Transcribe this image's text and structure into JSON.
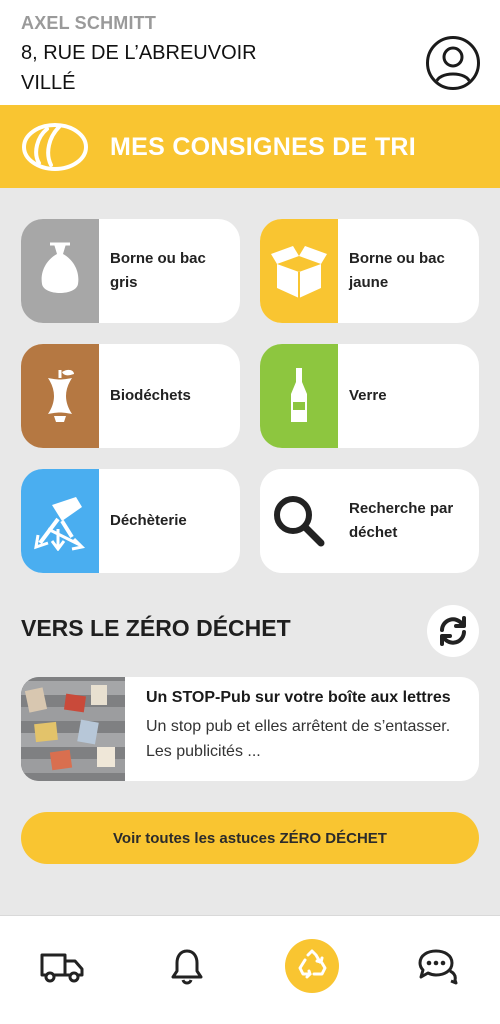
{
  "user": {
    "name": "AXEL SCHMITT",
    "street": "8, RUE DE L’ABREUVOIR",
    "city": "VILLÉ",
    "icon": "user-circle-icon"
  },
  "banner": {
    "title": "MES CONSIGNES DE TRI",
    "icon": "bread-logo-icon"
  },
  "tiles": [
    {
      "label": "Borne ou bac\ngris",
      "color": "#a7a7a7",
      "icon": "trash-bag-icon"
    },
    {
      "label": "Borne ou bac\njaune",
      "color": "#f9c531",
      "icon": "box-icon"
    },
    {
      "label": "Biodéchets",
      "color": "#b57842",
      "icon": "apple-core-icon"
    },
    {
      "label": "Verre",
      "color": "#8dc63f",
      "icon": "bottle-icon"
    },
    {
      "label": "Déchèterie",
      "color": "#4aaef0",
      "icon": "recycling-center-icon"
    },
    {
      "label": "Recherche par\ndéchet",
      "color": "#ffffff",
      "icon": "search-icon"
    }
  ],
  "zero": {
    "title": "VERS LE ZÉRO DÉCHET",
    "refresh_icon": "refresh-icon",
    "tip": {
      "title": "Un STOP-Pub sur votre boîte aux lettres",
      "text": "Un stop pub et elles arrêtent de s’entasser. Les publicités ..."
    },
    "all_button": "Voir toutes les astuces ZÉRO DÉCHET"
  },
  "nav": [
    {
      "icon": "truck-icon",
      "active": false
    },
    {
      "icon": "bell-icon",
      "active": false
    },
    {
      "icon": "recycle-icon",
      "active": true
    },
    {
      "icon": "chat-icon",
      "active": false
    }
  ],
  "colors": {
    "accent": "#f9c531",
    "background": "#e8e8e8"
  }
}
